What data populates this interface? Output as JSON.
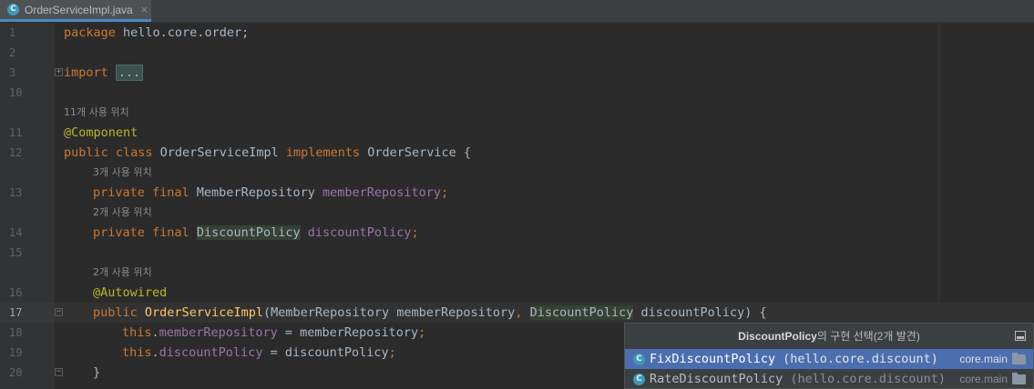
{
  "tab": {
    "filename": "OrderServiceImpl.java",
    "icon": "C",
    "close": "×"
  },
  "code": {
    "l1": {
      "num": "1",
      "kw": "package",
      "rest": " hello.core.order;"
    },
    "l2": {
      "num": "2"
    },
    "l3": {
      "num": "3",
      "kw": "import",
      "folded": "..."
    },
    "l10": {
      "num": "10"
    },
    "hint11": "11개 사용 위치",
    "l11": {
      "num": "11",
      "ann": "@Component"
    },
    "l12": {
      "num": "12",
      "kw1": "public class",
      "name": " OrderServiceImpl ",
      "kw2": "implements",
      "rest": " OrderService {"
    },
    "hint13": "3개 사용 위치",
    "l13": {
      "num": "13",
      "kw": "private final",
      "type": " MemberRepository ",
      "field": "memberRepository",
      "semi": ";"
    },
    "hint14": "2개 사용 위치",
    "l14": {
      "num": "14",
      "kw": "private final",
      "type": "DiscountPolicy",
      "field": "discountPolicy",
      "semi": ";"
    },
    "l15": {
      "num": "15"
    },
    "hint16": "2개 사용 위치",
    "l16": {
      "num": "16",
      "ann": "@Autowired"
    },
    "l17": {
      "num": "17",
      "kw": "public",
      "fn": "OrderServiceImpl",
      "p1": "(MemberRepository memberRepository",
      "comma": ",",
      "type2": "DiscountPolicy",
      "p2": " discountPolicy) {"
    },
    "l18": {
      "num": "18",
      "kw": "this",
      "dot": ".",
      "field": "memberRepository",
      "rest": " = memberRepository",
      "semi": ";"
    },
    "l19": {
      "num": "19",
      "kw": "this",
      "dot": ".",
      "field": "discountPolicy",
      "rest": " = discountPolicy",
      "semi": ";"
    },
    "l20": {
      "num": "20",
      "rest": "}"
    }
  },
  "popup": {
    "title_bold": "DiscountPolicy",
    "title_rest": "의 구현 선택(2개 발견)",
    "items": [
      {
        "name": "FixDiscountPolicy",
        "pkg": "(hello.core.discount)",
        "module": "core.main",
        "selected": true
      },
      {
        "name": "RateDiscountPolicy",
        "pkg": "(hello.core.discount)",
        "module": "core.main",
        "selected": false
      }
    ]
  },
  "colors": {
    "selection": "#4b6eaf",
    "keyword": "#cc7832",
    "annotation": "#bbb529",
    "field": "#9876aa",
    "method": "#ffc66d"
  }
}
